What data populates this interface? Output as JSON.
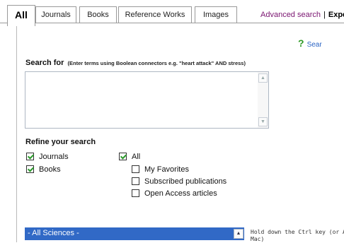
{
  "tabs": [
    {
      "label": "All",
      "active": true
    },
    {
      "label": "Journals",
      "active": false
    },
    {
      "label": "Books",
      "active": false
    },
    {
      "label": "Reference Works",
      "active": false
    },
    {
      "label": "Images",
      "active": false
    }
  ],
  "top_links": {
    "advanced_search": "Advanced search",
    "separator": "|",
    "expert": "Expe"
  },
  "help": {
    "icon": "?",
    "label": "Sear"
  },
  "search": {
    "label": "Search for",
    "hint": "(Enter terms using Boolean connectors e.g. \"heart attack\" AND stress)",
    "value": ""
  },
  "refine": {
    "title": "Refine your search",
    "content_types": [
      {
        "label": "Journals",
        "checked": true
      },
      {
        "label": "Books",
        "checked": true
      }
    ],
    "access": [
      {
        "label": "All",
        "checked": true
      },
      {
        "label": "My Favorites",
        "checked": false
      },
      {
        "label": "Subscribed publications",
        "checked": false
      },
      {
        "label": "Open Access articles",
        "checked": false
      }
    ]
  },
  "subject": {
    "selected": "- All Sciences -",
    "hint_line1": "Hold down the Ctrl key (or App",
    "hint_line2": "Mac)"
  },
  "colors": {
    "accent": "#3169c6",
    "link": "#7a1470",
    "help_link": "#2b64c4",
    "help_icon": "#2e9a24",
    "check": "#2a9a2a"
  }
}
